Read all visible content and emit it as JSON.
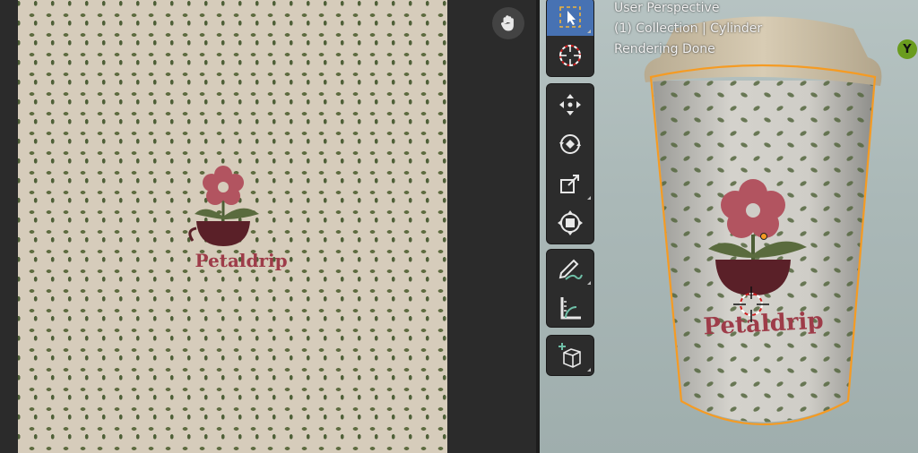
{
  "viewport": {
    "info_lines": [
      "User Perspective",
      "(1) Collection | Cylinder",
      "Rendering Done"
    ],
    "axis_label": "Y"
  },
  "texture": {
    "brand": "Petaldrip"
  },
  "toolbar": {
    "tools": [
      "select-box",
      "cursor",
      "move",
      "rotate",
      "scale",
      "transform",
      "annotate",
      "measure",
      "add-cube"
    ],
    "active_tool": "select-box"
  },
  "colors": {
    "accent_active": "#4772b3",
    "selection_outline": "#f59b23",
    "axis_y": "#6a9c1e",
    "logo_red": "#9e3c49",
    "leaf_green": "#5e6b45",
    "pot_dark": "#5a2028"
  }
}
